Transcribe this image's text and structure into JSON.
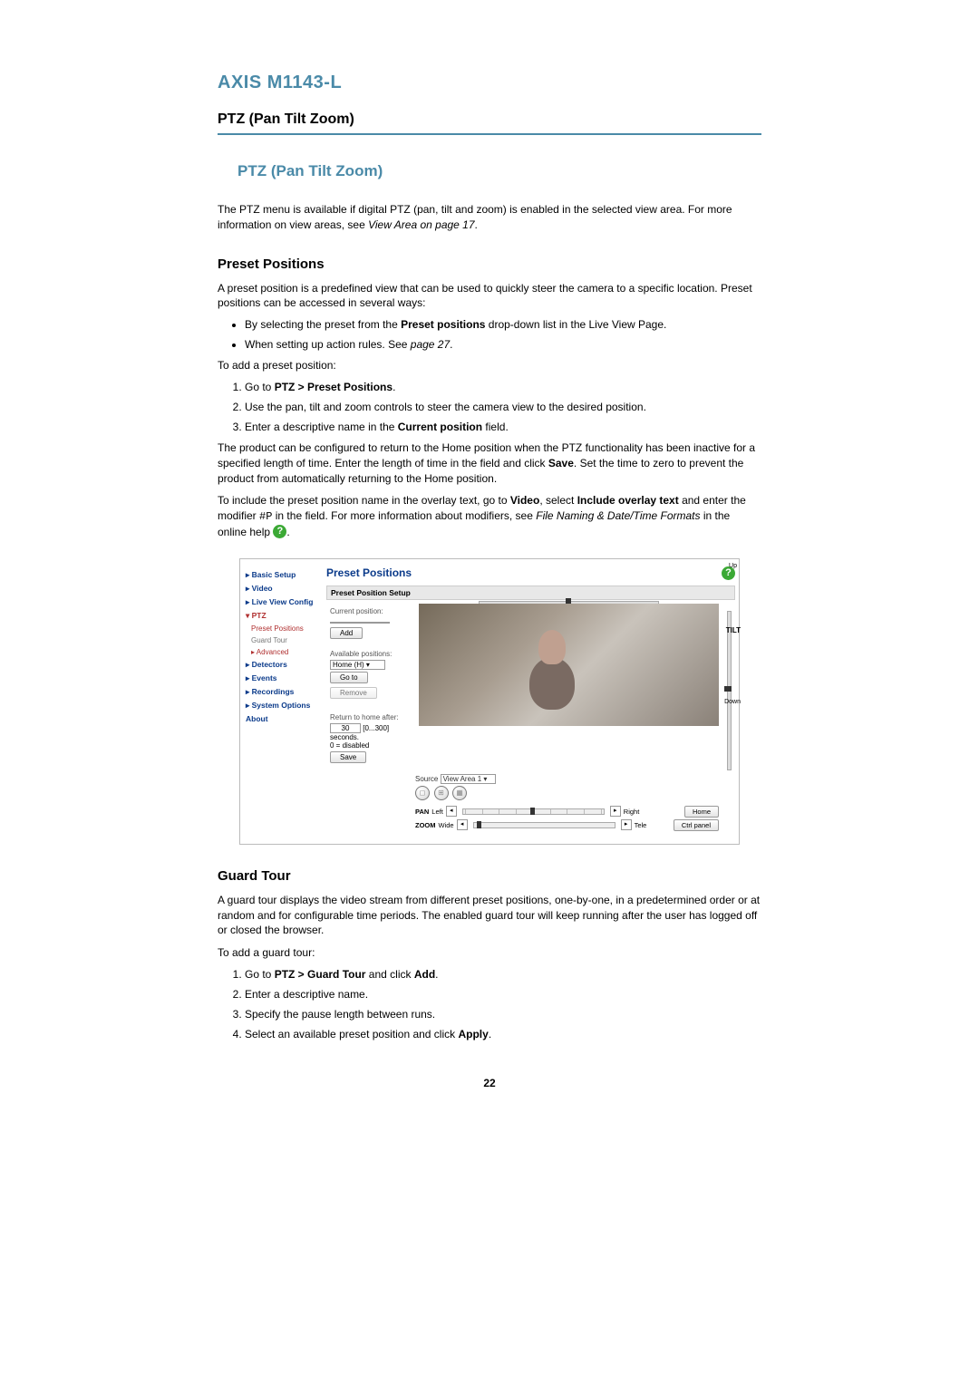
{
  "product": "AXIS M1143-L",
  "section": "PTZ (Pan Tilt Zoom)",
  "h2": "PTZ (Pan Tilt Zoom)",
  "intro_a": "The PTZ menu is available if digital PTZ (pan, tilt and zoom) is enabled in the selected view area. For more information on view areas, see ",
  "intro_ref": "View Area on page 17",
  "intro_b": ".",
  "preset": {
    "heading": "Preset Positions",
    "p1": "A preset position is a predefined view that can be used to quickly steer the camera to a specific location. Preset positions can be accessed in several ways:",
    "bullet1_a": "By selecting the preset from the ",
    "bullet1_b": "Preset positions",
    "bullet1_c": " drop-down list in the Live View Page.",
    "bullet2_a": "When setting up action rules. See ",
    "bullet2_ref": "page 27",
    "bullet2_b": ".",
    "p2": "To add a preset position:",
    "step1_a": "Go to ",
    "step1_b": "PTZ > Preset Positions",
    "step1_c": ".",
    "step2": "Use the pan, tilt and zoom controls to steer the camera view to the desired position.",
    "step3_a": "Enter a descriptive name in the ",
    "step3_b": "Current position",
    "step3_c": " field.",
    "p3_a": "The product can be configured to return to the Home position when the PTZ functionality has been inactive for a specified length of time. Enter the length of time in the field and click ",
    "p3_b": "Save",
    "p3_c": ". Set the time to zero to prevent the product from automatically returning to the Home position.",
    "p4_a": "To include the preset position name in the overlay text, go to ",
    "p4_b": "Video",
    "p4_c": ", select ",
    "p4_d": "Include overlay text",
    "p4_e": " and enter the modifier ",
    "p4_mod": "#P",
    "p4_f": " in the field. For more information about modifiers, see ",
    "p4_ref": "File Naming & Date/Time Formats",
    "p4_g": " in the online help ",
    "p4_h": "."
  },
  "screenshot": {
    "sidebar": {
      "basic": "▸ Basic Setup",
      "video": "▸ Video",
      "liveview": "▸ Live View Config",
      "ptz": "▾ PTZ",
      "preset_positions": "Preset Positions",
      "guard_tour": "Guard Tour",
      "advanced": "▸ Advanced",
      "detectors": "▸ Detectors",
      "events": "▸ Events",
      "recordings": "▸ Recordings",
      "system_options": "▸ System Options",
      "about": "About"
    },
    "title": "Preset Positions",
    "box_title": "Preset Position Setup",
    "current_position_label": "Current position:",
    "add_btn": "Add",
    "available_label": "Available positions:",
    "home_option": "Home (H)",
    "goto_btn": "Go to",
    "remove_btn": "Remove",
    "return_label": "Return to home after:",
    "return_value": "30",
    "return_suffix": "[0...300] seconds.",
    "return_note": "0 = disabled",
    "save_btn": "Save",
    "source_label": "Source",
    "source_value": "View Area 1",
    "pan_label": "PAN",
    "pan_left": "Left",
    "pan_right": "Right",
    "zoom_label": "ZOOM",
    "zoom_wide": "Wide",
    "zoom_tele": "Tele",
    "tilt_up": "Up",
    "tilt_label": "TILT",
    "tilt_down": "Down",
    "home_btn": "Home",
    "ctrl_btn": "Ctrl panel",
    "help_glyph": "?"
  },
  "guard": {
    "heading": "Guard Tour",
    "p1": "A guard tour displays the video stream from different preset positions, one-by-one, in a predetermined order or at random and for configurable time periods. The enabled guard tour will keep running after the user has logged off or closed the browser.",
    "p2": "To add a guard tour:",
    "step1_a": "Go to ",
    "step1_b": "PTZ > Guard Tour",
    "step1_c": " and click ",
    "step1_d": "Add",
    "step1_e": ".",
    "step2": "Enter a descriptive name.",
    "step3": "Specify the pause length between runs.",
    "step4_a": "Select an available preset position and click ",
    "step4_b": "Apply",
    "step4_c": "."
  },
  "page_number": "22"
}
